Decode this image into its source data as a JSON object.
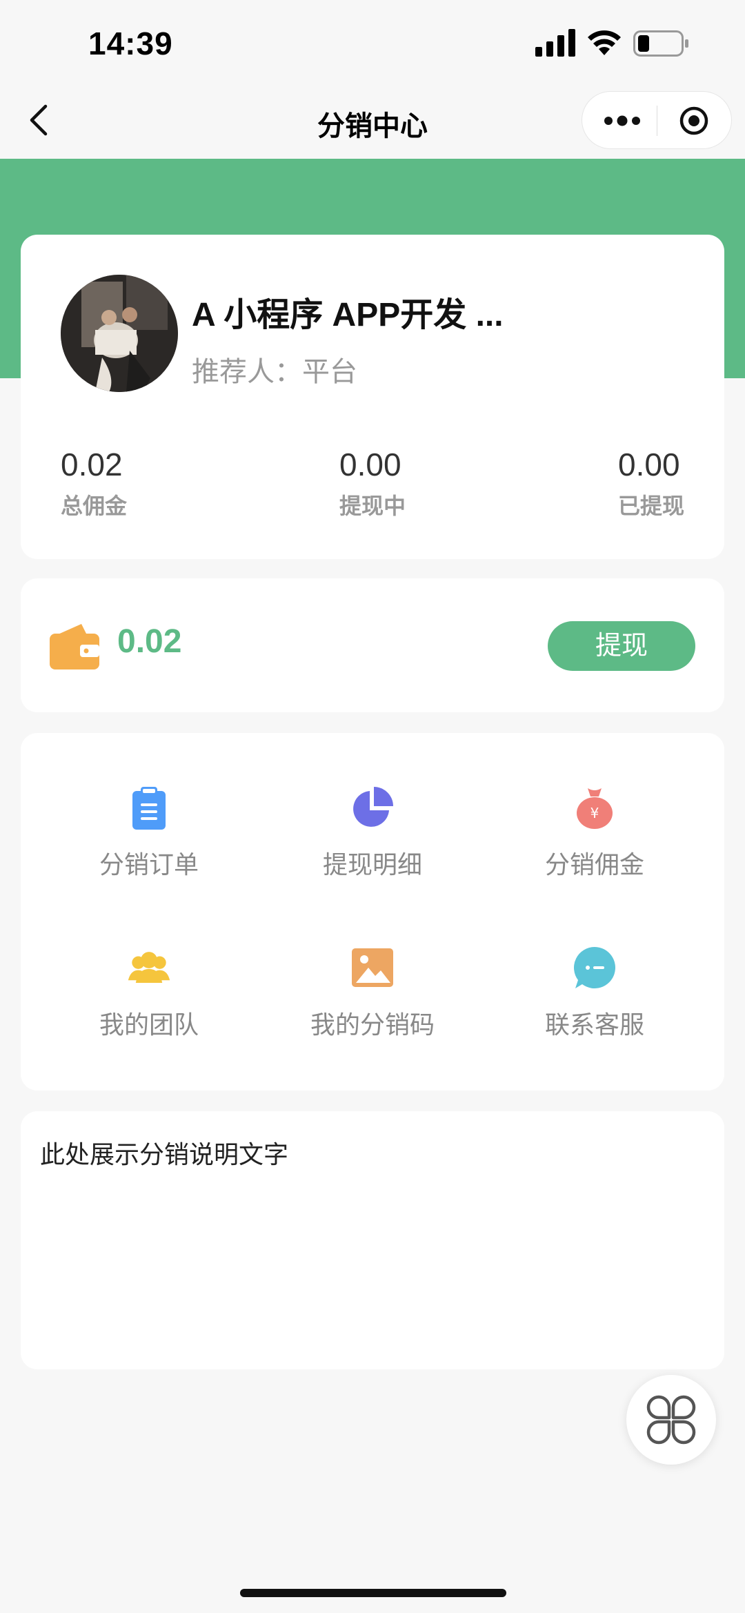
{
  "status_bar": {
    "time": "14:39"
  },
  "nav": {
    "title": "分销中心"
  },
  "profile": {
    "name": "A 小程序 APP开发 ...",
    "referrer": "推荐人：平台"
  },
  "stats": [
    {
      "value": "0.02",
      "label": "总佣金"
    },
    {
      "value": "0.00",
      "label": "提现中"
    },
    {
      "value": "0.00",
      "label": "已提现"
    }
  ],
  "wallet": {
    "balance": "0.02",
    "withdraw_label": "提现"
  },
  "menu": [
    {
      "label": "分销订单",
      "icon": "clipboard-icon",
      "color": "#4f9cf9"
    },
    {
      "label": "提现明细",
      "icon": "pie-chart-icon",
      "color": "#6d6fe6"
    },
    {
      "label": "分销佣金",
      "icon": "money-bag-icon",
      "color": "#f07f78"
    },
    {
      "label": "我的团队",
      "icon": "team-icon",
      "color": "#f5c53d"
    },
    {
      "label": "我的分销码",
      "icon": "image-icon",
      "color": "#eda662"
    },
    {
      "label": "联系客服",
      "icon": "chat-bubble-icon",
      "color": "#5bc4d8"
    }
  ],
  "description": {
    "text": "此处展示分销说明文字"
  },
  "colors": {
    "brand_green": "#5dba86",
    "wallet_orange": "#f5ae4b"
  }
}
